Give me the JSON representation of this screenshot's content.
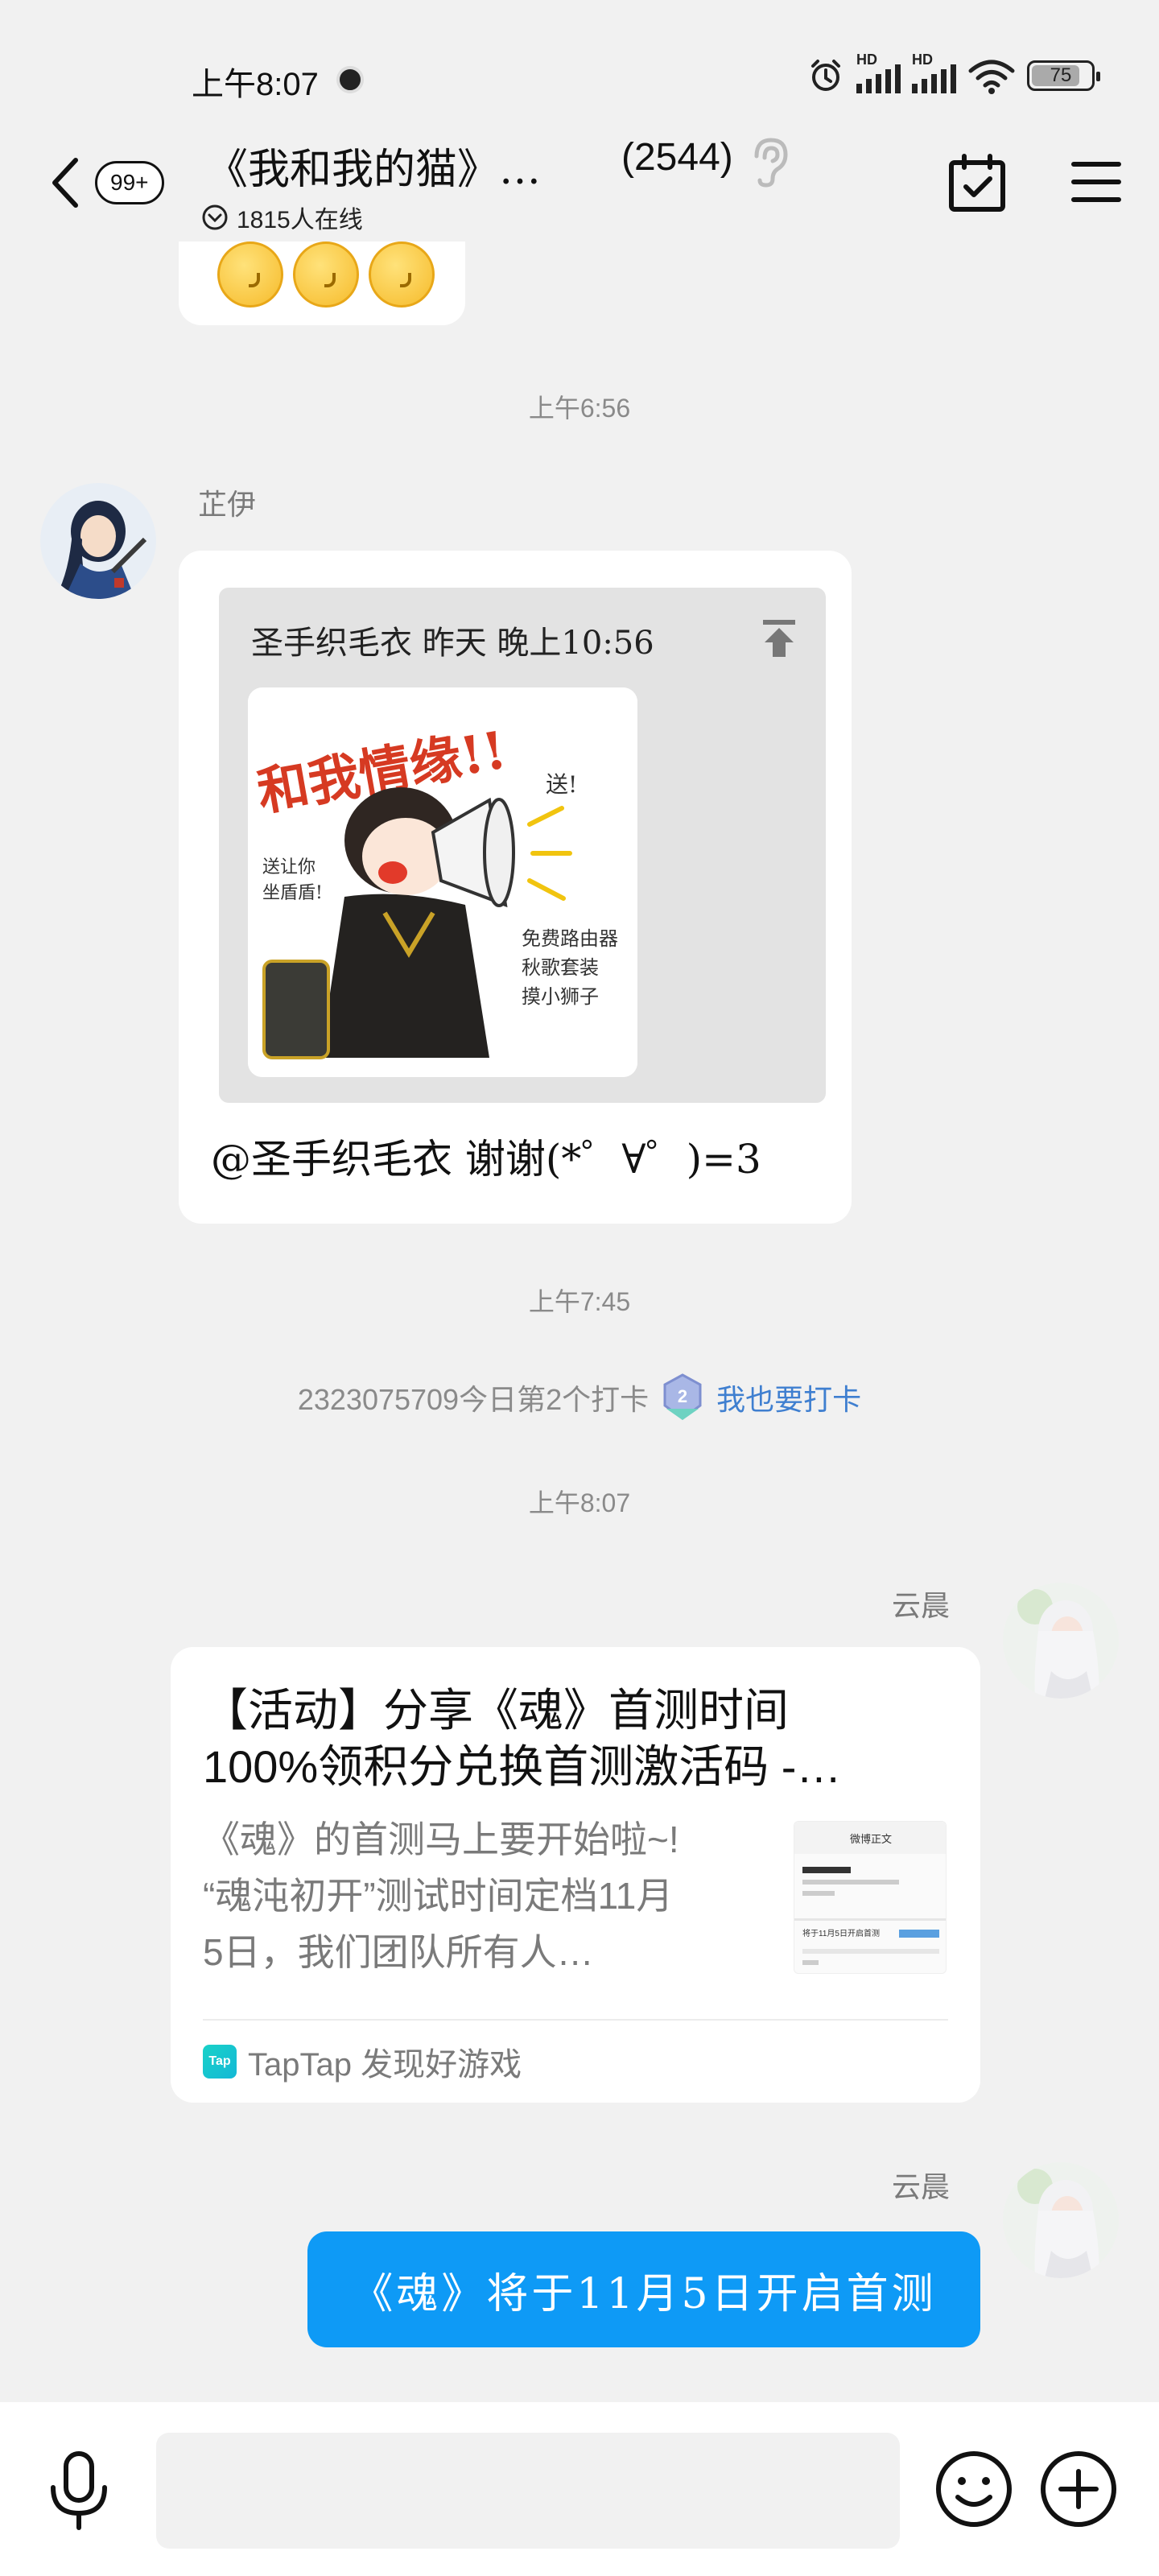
{
  "status_bar": {
    "time": "上午8:07",
    "network_label": "HD",
    "battery": "75"
  },
  "header": {
    "unread_badge": "99+",
    "title": "《我和我的猫》…",
    "member_count": "(2544)",
    "online_text": "1815人在线"
  },
  "messages": {
    "ts_1": "上午6:56",
    "sender_1": "芷伊",
    "quote_header": "圣手织毛衣  昨天  晚上10:56",
    "sticker_text": {
      "main": "和我情缘!!",
      "send": "送!",
      "left": "送让你\n坐盾盾!",
      "right1": "免费路由器",
      "right2": "秋歌套装",
      "right3": "摸小狮子"
    },
    "reply_text": "@圣手织毛衣  谢谢(*゜∀゜)=3",
    "ts_2": "上午7:45",
    "checkin_text": "2323075709今日第2个打卡",
    "checkin_badge": "2",
    "checkin_link": "我也要打卡",
    "ts_3": "上午8:07",
    "sender_2": "云晨",
    "card_title_1": "【活动】分享《魂》首测时间",
    "card_title_2": "100%领积分兑换首测激活码 -…",
    "card_desc_1": "《魂》的首测马上要开始啦~!",
    "card_desc_2": "“魂沌初开”测试时间定档11月",
    "card_desc_3": "5日，我们团队所有人…",
    "card_thumb_title": "微博正文",
    "card_thumb_line": "将于11月5日开启首测",
    "card_source": "TapTap 发现好游戏",
    "taptap_logo": "Tap",
    "sender_3": "云晨",
    "blue_message": "《魂》将于11月5日开启首测"
  },
  "colors": {
    "background": "#f1f1f1",
    "accent_blue": "#0e9af6",
    "link_blue": "#3f7fd0"
  }
}
